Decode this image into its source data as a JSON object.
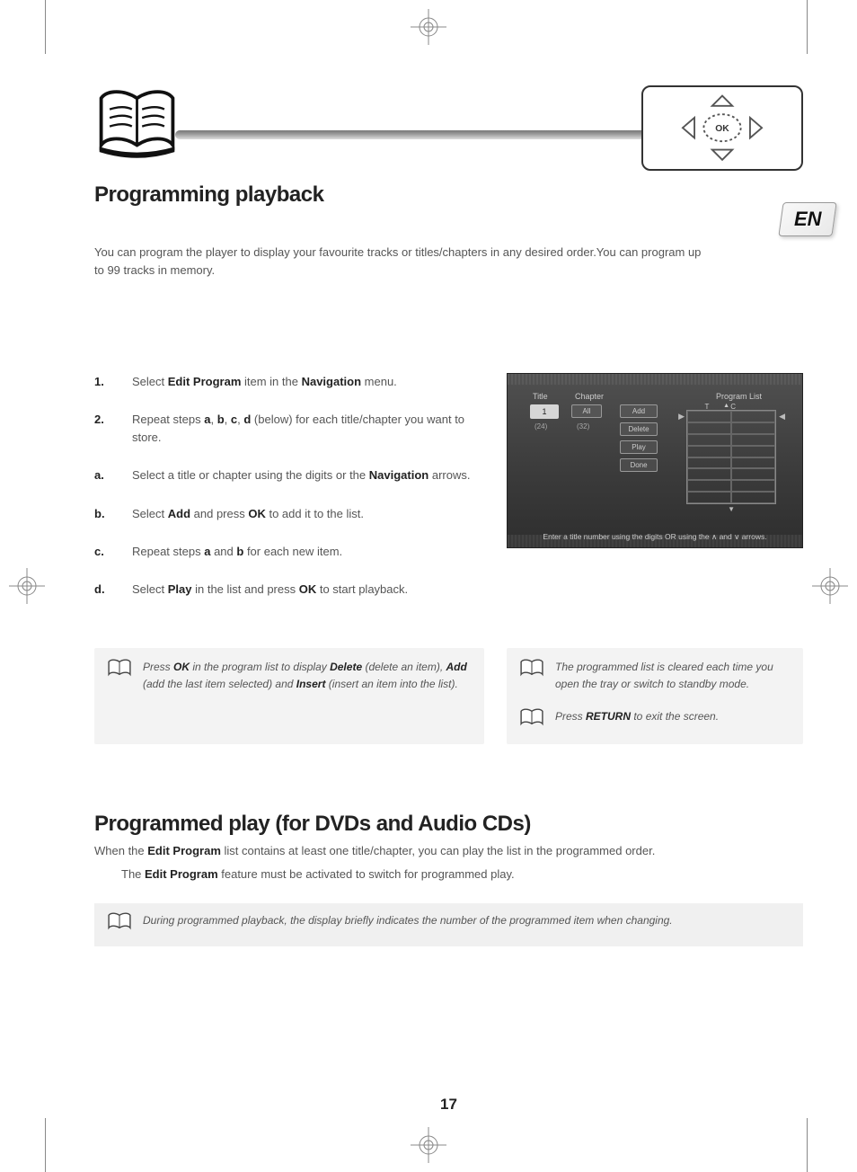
{
  "header": {
    "section_title": "Programming playback",
    "nav_box_label": "OK",
    "lang_flag": "EN"
  },
  "intro": "You can program the player to display your favourite tracks or titles/chapters in any desired order.You can program up to 99 tracks in memory.",
  "steps": {
    "s1": {
      "num": "1.",
      "pre": "Select ",
      "b1": "Edit Program",
      "mid": " item in the ",
      "b2": "Navigation",
      "post": " menu."
    },
    "s2": {
      "num": "2.",
      "pre": "Repeat steps ",
      "b1": "a",
      "c1": ", ",
      "b2": "b",
      "c2": ", ",
      "b3": "c",
      "c3": ", ",
      "b4": "d",
      "post": " (below) for each title/chapter you want to store."
    },
    "sa": {
      "num": "a.",
      "pre": "Select a title or chapter using the digits or the ",
      "b1": "Navigation",
      "post": " arrows."
    },
    "sb": {
      "num": "b.",
      "pre": "Select ",
      "b1": "Add",
      "mid": " and press ",
      "b2": "OK",
      "post": " to add it to the list."
    },
    "sc": {
      "num": "c.",
      "pre": "Repeat steps ",
      "b1": "a",
      "mid": " and ",
      "b2": "b",
      "post": " for each new item."
    },
    "sd": {
      "num": "d.",
      "pre": "Select ",
      "b1": "Play",
      "mid": " in the list and press ",
      "b2": "OK",
      "post": " to start playback."
    }
  },
  "osd": {
    "title_label": "Title",
    "chapter_label": "Chapter",
    "program_list_label": "Program List",
    "title_value": "1",
    "title_total": "(24)",
    "chapter_value": "All",
    "chapter_total": "(32)",
    "plist_head_t": "T",
    "plist_head_c": "C",
    "btn_add": "Add",
    "btn_delete": "Delete",
    "btn_play": "Play",
    "btn_done": "Done",
    "hint": "Enter a title number using the digits OR using the ∧ and ∨ arrows."
  },
  "notes": {
    "left": {
      "pre": "Press ",
      "ok": "OK",
      "mid": " in the program list to display ",
      "del": "Delete",
      "mid2": " (delete an item), ",
      "add": "Add",
      "mid3": " (add the last item selected) and ",
      "ins": "Insert",
      "post": " (insert an item into the list)."
    },
    "right_top": "The programmed list is cleared each time you open the tray or switch to standby mode.",
    "right_bot_pre": "Press ",
    "right_bot_b": "RETURN",
    "right_bot_post": " to exit the screen."
  },
  "section2": {
    "title": "Programmed play (for DVDs and Audio CDs)",
    "line1_pre": "When the ",
    "line1_b": "Edit Program",
    "line1_post": " list contains at least one title/chapter, you can play the list in the programmed order.",
    "line2_pre": "The ",
    "line2_b": "Edit Program",
    "line2_post": " feature must be activated to switch for programmed play.",
    "note": "During programmed playback, the display briefly indicates the number of the programmed item when changing."
  },
  "page_number": "17"
}
